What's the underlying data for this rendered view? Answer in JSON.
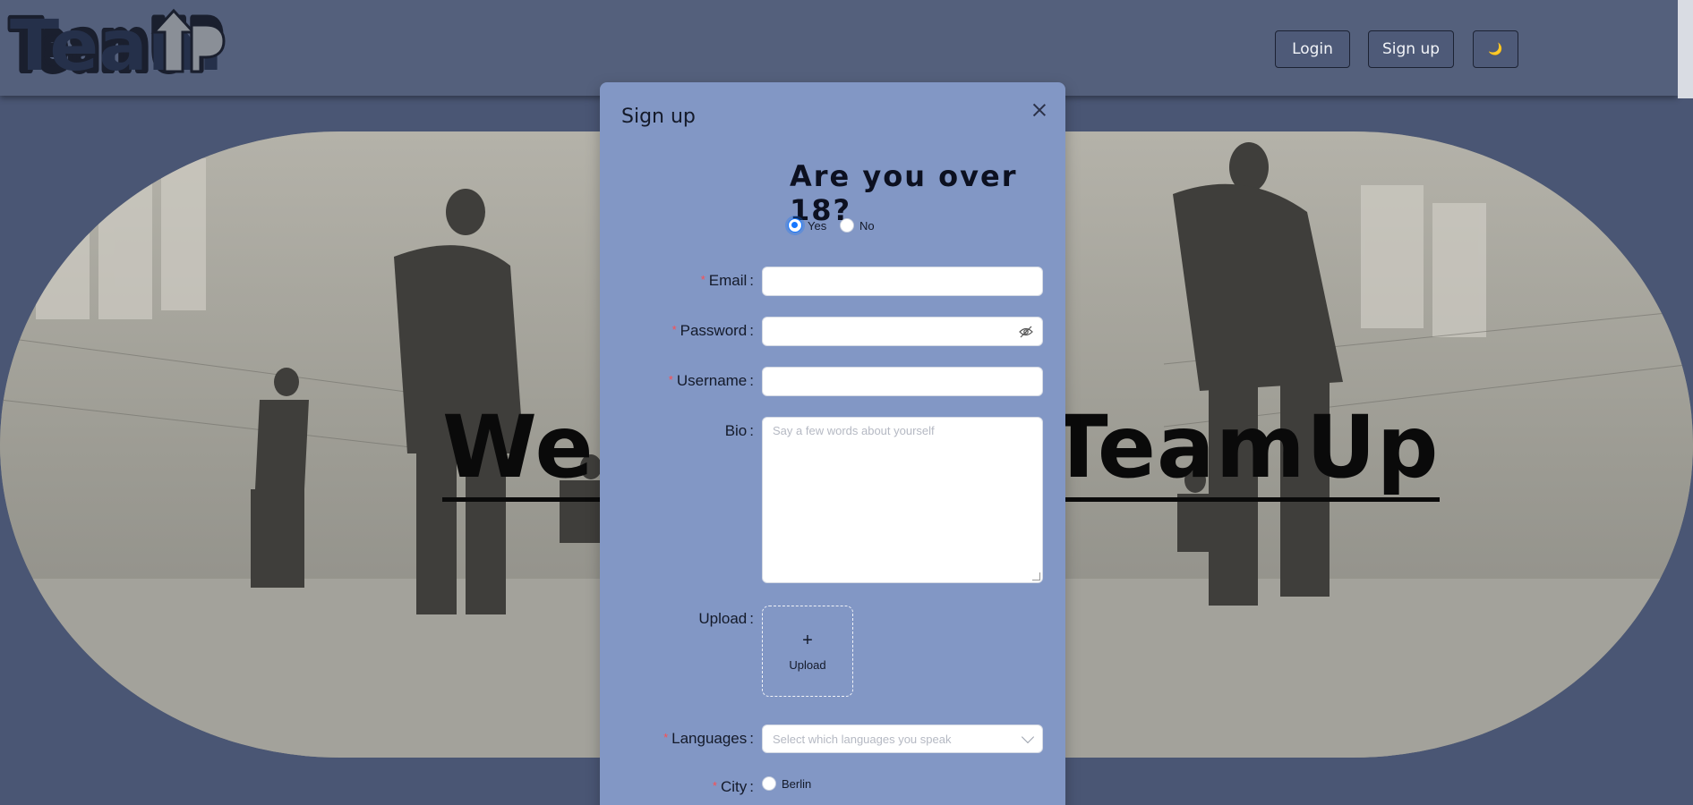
{
  "header": {
    "logo_text": "TeamUP",
    "login_label": "Login",
    "signup_label": "Sign up",
    "theme_icon": "🌙"
  },
  "hero": {
    "title": "Welcome to TeamUp"
  },
  "modal": {
    "title": "Sign up",
    "age_question": "Are you over 18?",
    "age_options": [
      {
        "label": "Yes",
        "selected": true
      },
      {
        "label": "No",
        "selected": false
      }
    ],
    "fields": {
      "email": {
        "label": "Email",
        "required": true,
        "value": ""
      },
      "password": {
        "label": "Password",
        "required": true,
        "value": ""
      },
      "username": {
        "label": "Username",
        "required": true,
        "value": ""
      },
      "bio": {
        "label": "Bio",
        "required": false,
        "placeholder": "Say a few words about yourself"
      },
      "upload": {
        "label": "Upload",
        "button_label": "Upload"
      },
      "languages": {
        "label": "Languages",
        "required": true,
        "placeholder": "Select which languages you speak"
      },
      "city": {
        "label": "City",
        "required": true,
        "options": [
          "Berlin"
        ]
      }
    }
  },
  "colors": {
    "header_bg": "#54607c",
    "page_bg": "#4a5674",
    "modal_bg": "#8297c5",
    "required_mark": "#ff4d4f",
    "radio_accent": "#1677ff"
  }
}
